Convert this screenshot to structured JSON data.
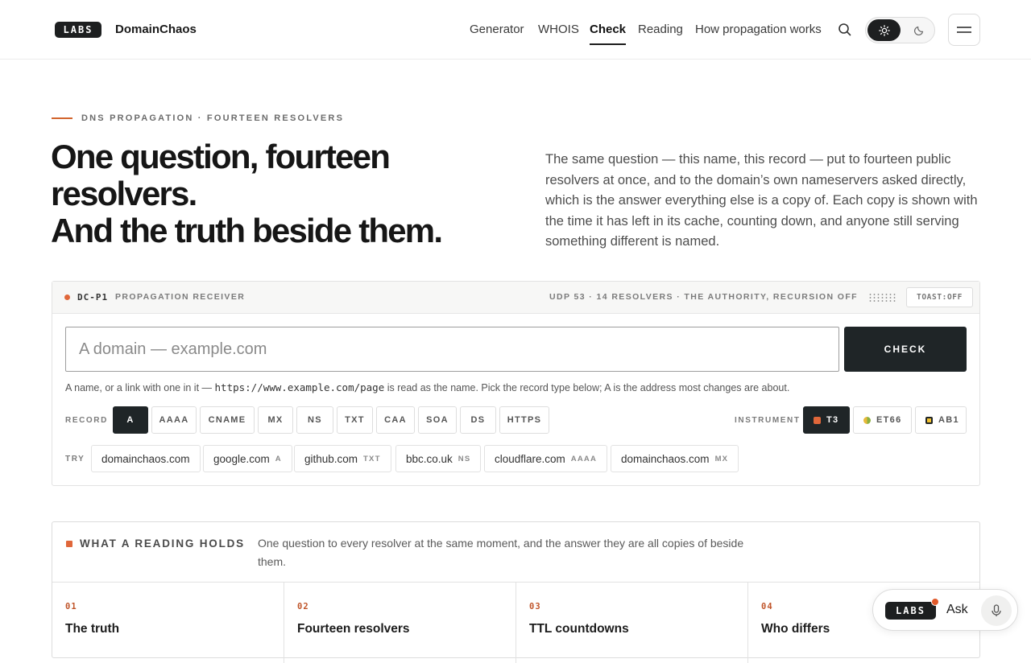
{
  "header": {
    "logo": "LABS",
    "brand": "DomainChaos",
    "nav": [
      "Generator",
      "WHOIS",
      "Check",
      "Reading",
      "How propagation works"
    ],
    "active_nav": "Check",
    "icons": {
      "search": "search-icon",
      "light": "sun-icon",
      "dark": "moon-icon",
      "menu": "menu-icon"
    }
  },
  "hero": {
    "eyebrow": "DNS PROPAGATION · FOURTEEN RESOLVERS",
    "headline_line1": "One question, fourteen resolvers.",
    "headline_line2": "And the truth beside them.",
    "lead": "The same question — this name, this record — put to fourteen public resolvers at once, and to the domain’s own nameservers asked directly, which is the answer everything else is a copy of. Each copy is shown with the time it has left in its cache, counting down, and anyone still serving something different is named."
  },
  "receiver": {
    "id": "DC-P1",
    "name": "PROPAGATION RECEIVER",
    "meta": "UDP 53 · 14 RESOLVERS · THE AUTHORITY, RECURSION OFF",
    "toast": "TOAST:OFF",
    "input_placeholder": "A domain — example.com",
    "input_value": "",
    "check_label": "CHECK",
    "hint_before": "A name, or a link with one in it — ",
    "hint_code": "https://www.example.com/page",
    "hint_after": " is read as the name. Pick the record type below; A is the address most changes are about.",
    "record_label": "RECORD",
    "records": [
      "A",
      "AAAA",
      "CNAME",
      "MX",
      "NS",
      "TXT",
      "CAA",
      "SOA",
      "DS",
      "HTTPS"
    ],
    "selected_record": "A",
    "instrument_label": "INSTRUMENT",
    "instruments": [
      {
        "label": "T3",
        "color": "#e0673a",
        "selected": true
      },
      {
        "label": "ET66",
        "color": "#9bb33a",
        "selected": false
      },
      {
        "label": "AB1",
        "color": "#f2c230",
        "selected": false
      }
    ],
    "try_label": "TRY",
    "try_items": [
      {
        "domain": "domainchaos.com",
        "type": ""
      },
      {
        "domain": "google.com",
        "type": "A"
      },
      {
        "domain": "github.com",
        "type": "TXT"
      },
      {
        "domain": "bbc.co.uk",
        "type": "NS"
      },
      {
        "domain": "cloudflare.com",
        "type": "AAAA"
      },
      {
        "domain": "domainchaos.com",
        "type": "MX"
      }
    ]
  },
  "reading": {
    "title": "WHAT A READING HOLDS",
    "desc": "One question to every resolver at the same moment, and the answer they are all copies of beside them.",
    "columns": [
      {
        "num": "01",
        "title": "The truth"
      },
      {
        "num": "02",
        "title": "Fourteen resolvers"
      },
      {
        "num": "03",
        "title": "TTL countdowns"
      },
      {
        "num": "04",
        "title": "Who differs"
      }
    ]
  },
  "ask": {
    "logo": "LABS",
    "label": "Ask",
    "icon": "microphone-icon"
  }
}
